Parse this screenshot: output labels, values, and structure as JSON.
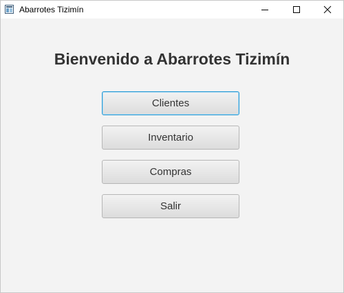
{
  "window": {
    "title": "Abarrotes Tizimín",
    "controls": {
      "minimize": "minimize-icon",
      "maximize": "maximize-icon",
      "close": "close-icon"
    }
  },
  "main": {
    "heading": "Bienvenido a Abarrotes Tizimín",
    "buttons": [
      {
        "label": "Clientes",
        "focused": true
      },
      {
        "label": "Inventario",
        "focused": false
      },
      {
        "label": "Compras",
        "focused": false
      },
      {
        "label": "Salir",
        "focused": false
      }
    ]
  },
  "colors": {
    "background": "#f3f3f3",
    "titlebar": "#ffffff",
    "focus_border": "#2d9bd4",
    "text": "#333333"
  }
}
